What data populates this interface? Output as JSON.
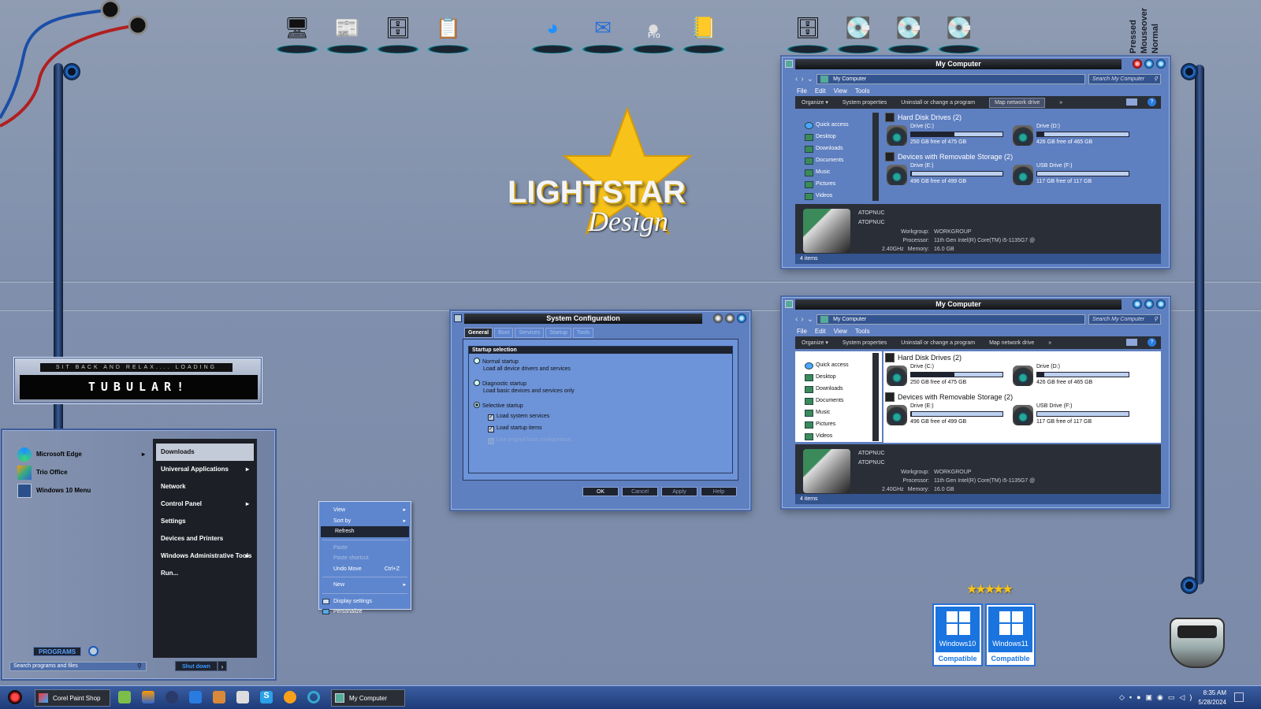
{
  "state_labels": [
    "Pressed",
    "Mouseover",
    "Normal"
  ],
  "dock": {
    "left_icons": [
      "computer-icon",
      "document-icon",
      "server-icon",
      "checklist-icon"
    ],
    "middle_icons": [
      "edge-icon",
      "thunderbird-icon",
      "google-earth-pro-icon",
      "contacts-icon"
    ],
    "middle_badge": "Pro",
    "right_icons": [
      "tower-icon",
      "drive-icon",
      "drive-icon",
      "drive-icon"
    ]
  },
  "logo": {
    "line1": "LIGHTSTAR",
    "line2": "Design"
  },
  "loading": {
    "line1": "SIT BACK AND RELAX.... LOADING",
    "line2": "TUBULAR!"
  },
  "explorer": {
    "title": "My Computer",
    "address": "My Computer",
    "search_placeholder": "Search My Computer",
    "menu": [
      "File",
      "Edit",
      "View",
      "Tools"
    ],
    "commands": [
      "Organize",
      "System properties",
      "Uninstall or change a program",
      "Map network drive",
      "»"
    ],
    "nav": [
      "Quick access",
      "Desktop",
      "Downloads",
      "Documents",
      "Music",
      "Pictures",
      "Videos"
    ],
    "section_hdd": "Hard Disk Drives (2)",
    "section_removable": "Devices with Removable Storage (2)",
    "drives": [
      {
        "name": "Drive (C:)",
        "free": "250 GB free of 475 GB",
        "used_fraction": 0.47
      },
      {
        "name": "Drive (D:)",
        "free": "426 GB free of 465 GB",
        "used_fraction": 0.08
      },
      {
        "name": "Drive (E:)",
        "free": "496 GB free of 499 GB",
        "used_fraction": 0.01
      },
      {
        "name": "USB Drive (F:)",
        "free": "117 GB free of 117 GB",
        "used_fraction": 0.0
      }
    ],
    "pc_name": "ATOPNUC",
    "pc_name2": "ATOPNUC",
    "details": [
      {
        "k": "Workgroup:",
        "v": "WORKGROUP"
      },
      {
        "k": "Processor:",
        "v": "11th Gen Intel(R) Core(TM) i5-1135G7 @ 2.40GHz"
      },
      {
        "k": "Memory:",
        "v": "16.0 GB"
      }
    ],
    "status": "4 items"
  },
  "sysconfig": {
    "title": "System Configuration",
    "tabs": [
      "General",
      "Boot",
      "Services",
      "Startup",
      "Tools"
    ],
    "group": "Startup selection",
    "normal": "Normal startup",
    "normal_desc": "Load all device drivers and services",
    "diag": "Diagnostic startup",
    "diag_desc": "Load basic devices and services only",
    "selective": "Selective startup",
    "chk1": "Load system services",
    "chk2": "Load startup items",
    "chk3": "Use original boot configuration",
    "buttons": [
      "OK",
      "Cancel",
      "Apply",
      "Help"
    ]
  },
  "context_menu": {
    "view": "View",
    "sort": "Sort by",
    "refresh": "Refresh",
    "paste": "Paste",
    "paste_shortcut": "Paste shortcut",
    "undo": "Undo Move",
    "undo_sc": "Ctrl+Z",
    "new": "New",
    "display": "Display settings",
    "personalize": "Personalize"
  },
  "start_menu": {
    "pinned": [
      "Microsoft Edge",
      "Trio Office",
      "Windows 10 Menu"
    ],
    "places": [
      "Downloads",
      "Universal Applications",
      "Network",
      "Control Panel",
      "Settings",
      "Devices and Printers",
      "Windows Administrative Tools",
      "Run..."
    ],
    "programs": "PROGRAMS",
    "search_placeholder": "Search programs and files",
    "shutdown": "Shut down"
  },
  "badges": [
    {
      "title": "Windows10",
      "sub": "Compatible"
    },
    {
      "title": "Windows11",
      "sub": "Compatible"
    }
  ],
  "taskbar": {
    "app1": "Corel Paint Shop P...",
    "app2": "My Computer",
    "time": "8:35 AM",
    "date": "5/28/2024"
  }
}
